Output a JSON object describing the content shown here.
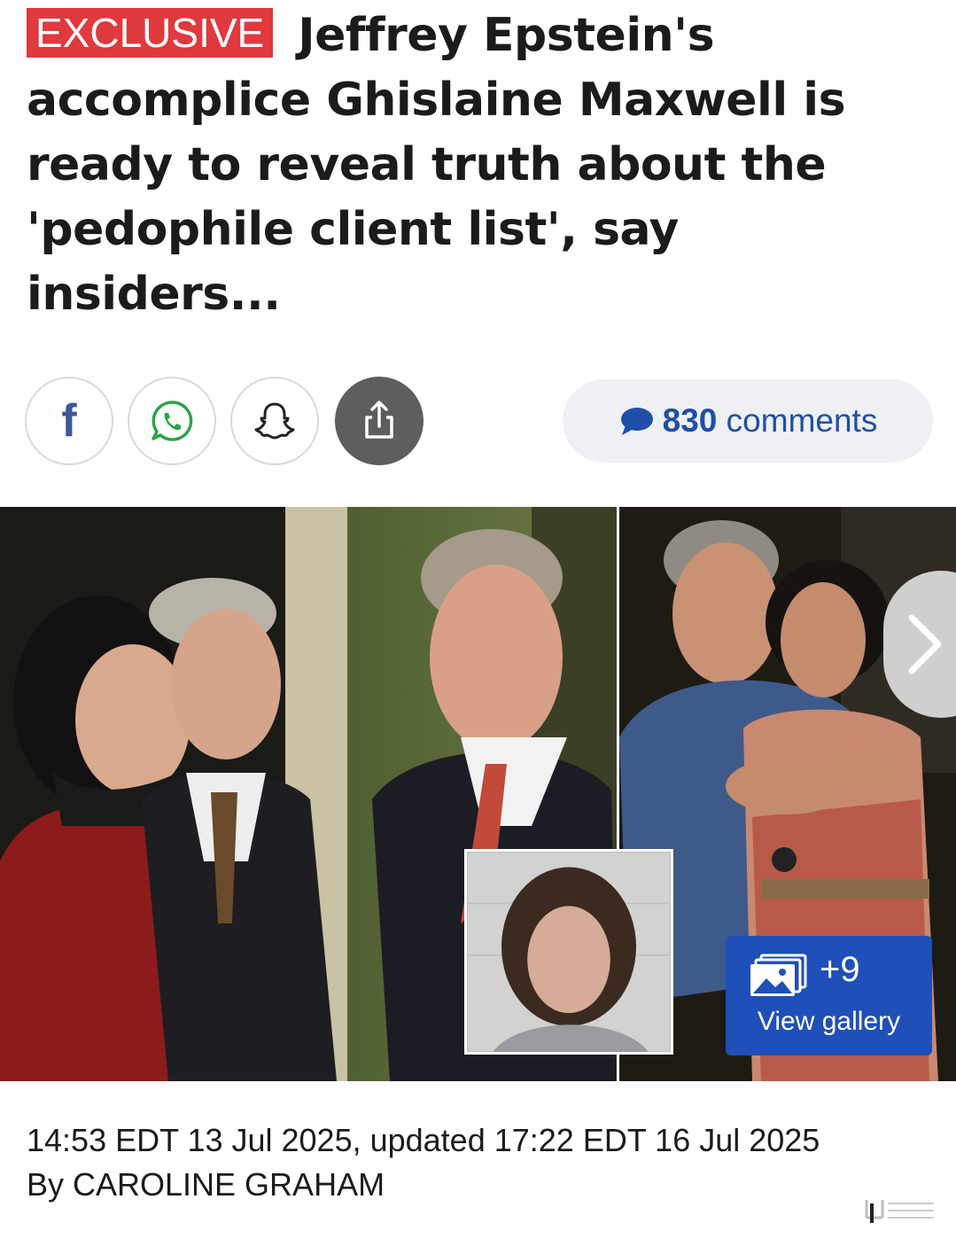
{
  "article": {
    "badge": "EXCLUSIVE",
    "title": "Jeffrey Epstein's accomplice Ghislaine Maxwell is ready to reveal truth about the 'pedophile client list', say insiders...",
    "timestamp": "14:53 EDT 13 Jul 2025, updated 17:22 EDT 16 Jul 2025",
    "byline": "By CAROLINE GRAHAM"
  },
  "share": {
    "buttons": [
      {
        "name": "facebook",
        "icon": "facebook-icon"
      },
      {
        "name": "whatsapp",
        "icon": "whatsapp-icon"
      },
      {
        "name": "snapchat",
        "icon": "snapchat-icon"
      },
      {
        "name": "share",
        "icon": "share-icon"
      }
    ],
    "comments_count": "830",
    "comments_label": "comments"
  },
  "gallery": {
    "count": "+9",
    "label": "View gallery",
    "next_icon": "chevron-right-icon"
  },
  "colors": {
    "badge": "#e0393e",
    "link": "#1f4fa8",
    "gallery_button": "#1f4fb8",
    "share_dark": "#5e5e5e"
  }
}
